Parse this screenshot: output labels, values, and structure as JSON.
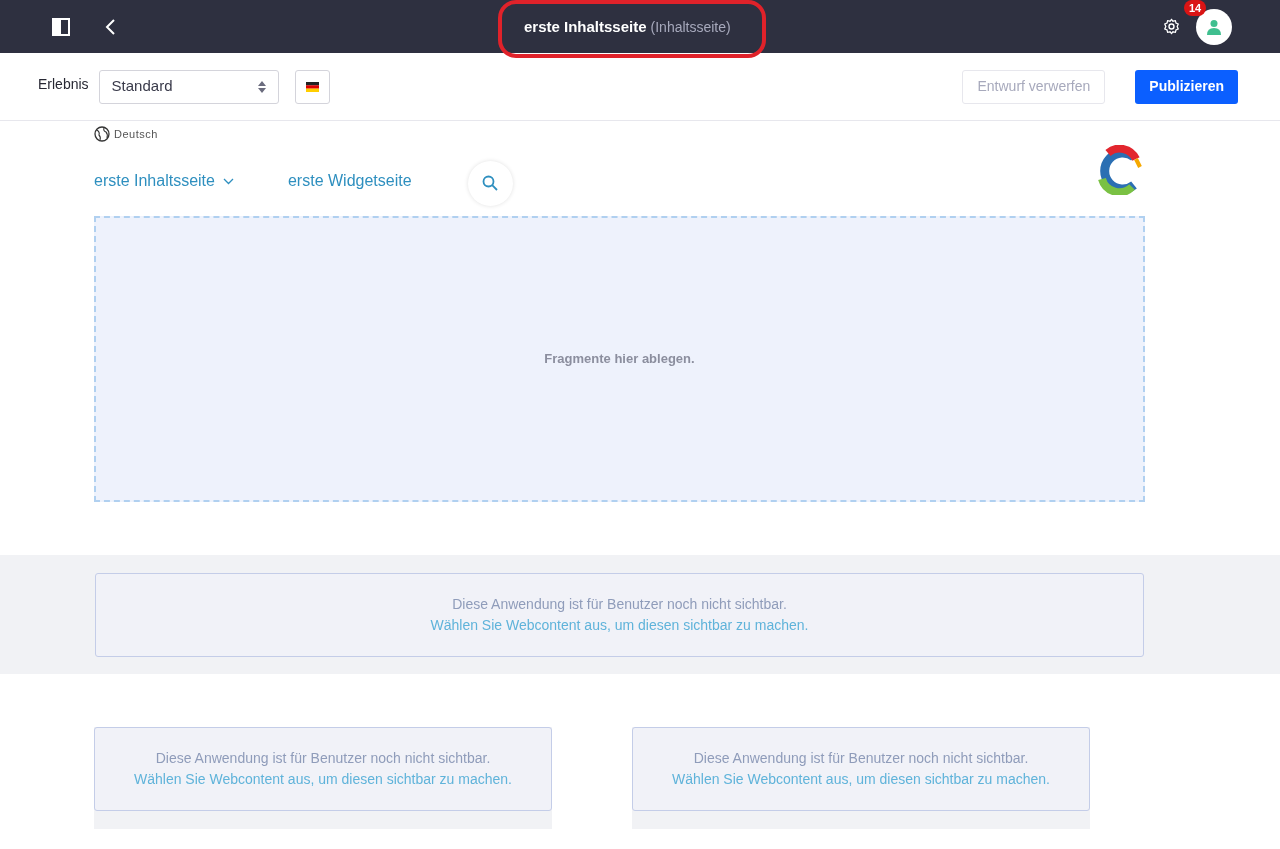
{
  "header": {
    "title": "erste Inhaltsseite",
    "subtitle": "(Inhaltsseite)",
    "notification_count": "14"
  },
  "toolbar": {
    "experience_label": "Erlebnis",
    "experience_value": "Standard",
    "discard_button": "Entwurf verwerfen",
    "discard_disabled": true,
    "publish_button": "Publizieren"
  },
  "site": {
    "language": "Deutsch",
    "nav": [
      {
        "label": "erste Inhaltsseite",
        "has_dropdown": true
      },
      {
        "label": "erste Widgetseite",
        "has_dropdown": false
      }
    ]
  },
  "drop_zone": {
    "text": "Fragmente hier ablegen."
  },
  "wide_widget": {
    "message": "Diese Anwendung ist für Benutzer noch nicht sichtbar.",
    "action": "Wählen Sie Webcontent aus, um diesen sichtbar zu machen."
  },
  "column_widgets": [
    {
      "message": "Diese Anwendung ist für Benutzer noch nicht sichtbar.",
      "action": "Wählen Sie Webcontent aus, um diesen sichtbar zu machen."
    },
    {
      "message": "Diese Anwendung ist für Benutzer noch nicht sichtbar.",
      "action": "Wählen Sie Webcontent aus, um diesen sichtbar zu machen."
    }
  ]
}
